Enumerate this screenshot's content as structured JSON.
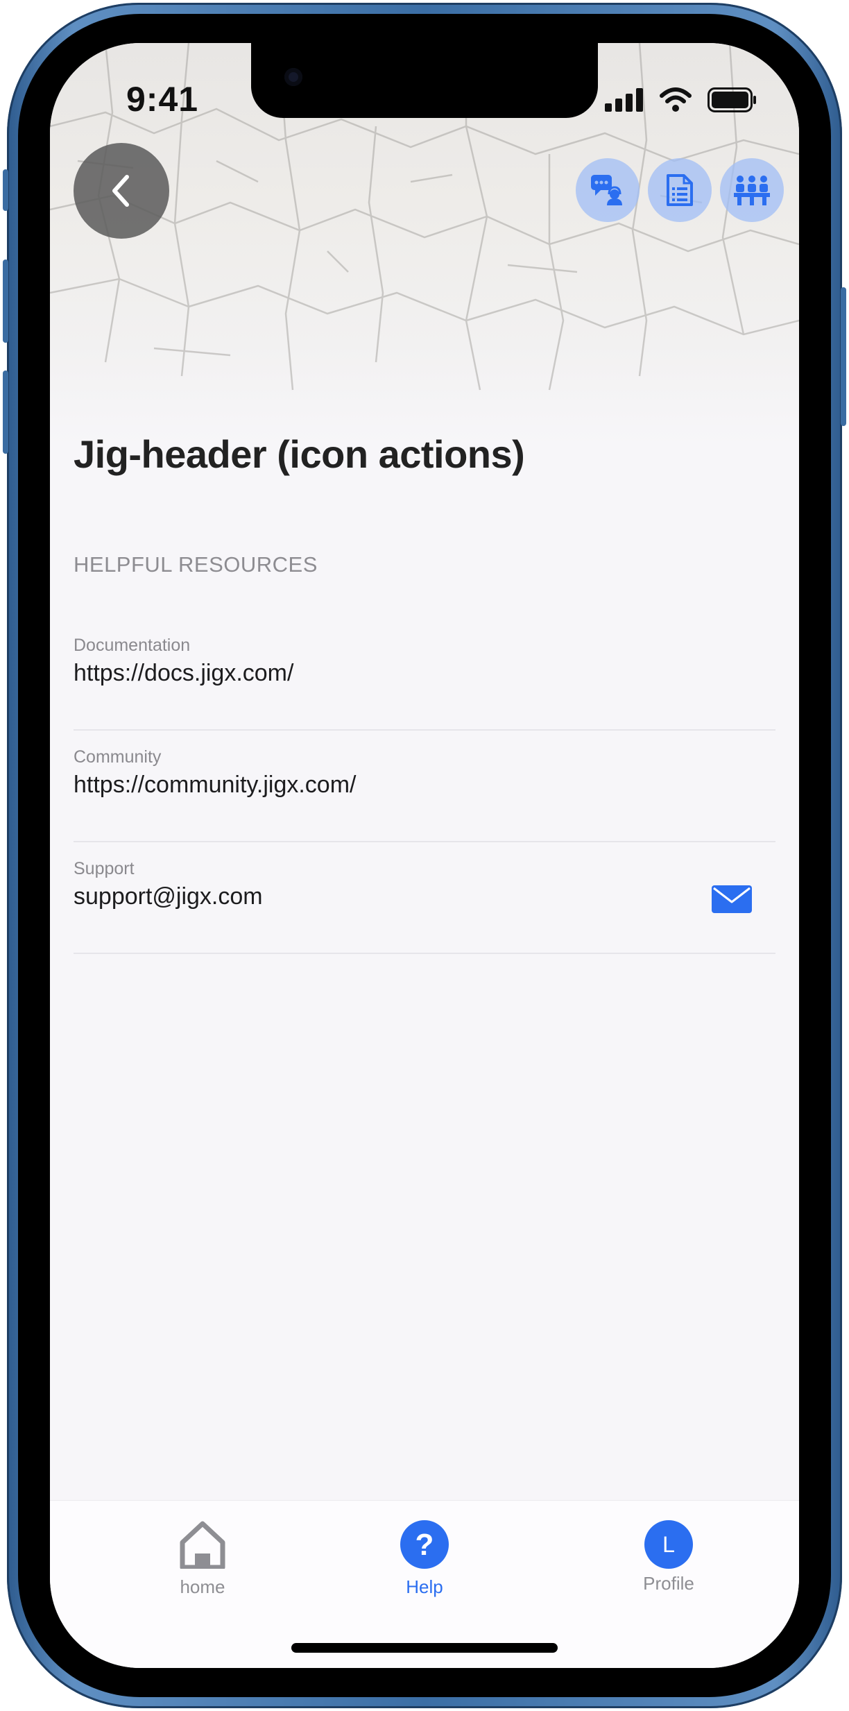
{
  "status_bar": {
    "time": "9:41"
  },
  "header": {
    "title": "Jig-header (icon actions)",
    "actions": [
      {
        "icon": "support-chat-icon"
      },
      {
        "icon": "document-icon"
      },
      {
        "icon": "community-icon"
      }
    ]
  },
  "section": {
    "title": "HELPFUL RESOURCES"
  },
  "resources": [
    {
      "label": "Documentation",
      "value": "https://docs.jigx.com/"
    },
    {
      "label": "Community",
      "value": "https://community.jigx.com/"
    },
    {
      "label": "Support",
      "value": "support@jigx.com",
      "icon": "mail-icon"
    }
  ],
  "tab_bar": {
    "tabs": [
      {
        "label": "home",
        "icon": "home-icon",
        "active": false
      },
      {
        "label": "Help",
        "icon": "help-icon",
        "active": true
      },
      {
        "label": "Profile",
        "avatar_initial": "L",
        "active": false
      }
    ]
  },
  "colors": {
    "accent": "#2B6EF0",
    "background": "#F7F6F9",
    "frame": "#3B6EA5"
  }
}
